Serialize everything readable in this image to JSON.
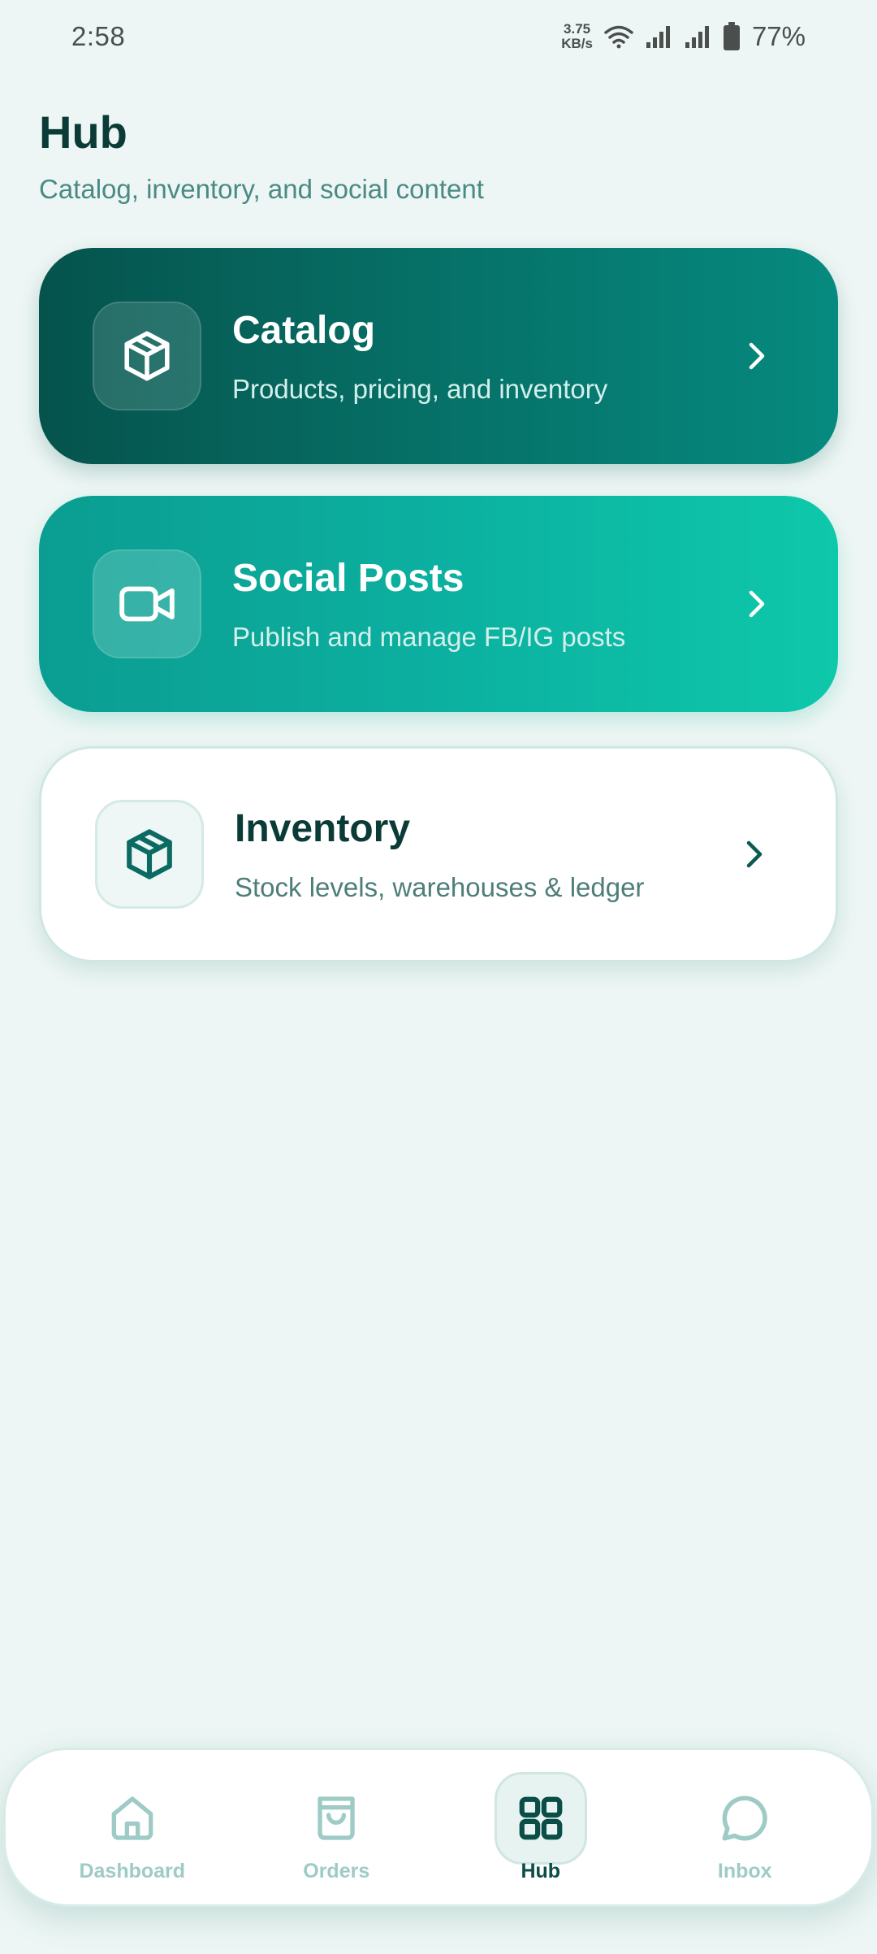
{
  "status_bar": {
    "time": "2:58",
    "net_speed_value": "3.75",
    "net_speed_unit": "KB/s",
    "battery": "77%"
  },
  "header": {
    "title": "Hub",
    "subtitle": "Catalog, inventory, and social content"
  },
  "cards": [
    {
      "title": "Catalog",
      "description": "Products, pricing, and inventory",
      "icon": "package-icon"
    },
    {
      "title": "Social Posts",
      "description": "Publish and manage FB/IG posts",
      "icon": "video-icon"
    },
    {
      "title": "Inventory",
      "description": "Stock levels, warehouses & ledger",
      "icon": "package-icon"
    }
  ],
  "nav": {
    "items": [
      {
        "label": "Dashboard",
        "icon": "home-icon",
        "active": false
      },
      {
        "label": "Orders",
        "icon": "shopping-bag-icon",
        "active": false
      },
      {
        "label": "Hub",
        "icon": "grid-icon",
        "active": true
      },
      {
        "label": "Inbox",
        "icon": "chat-bubble-icon",
        "active": false
      }
    ]
  },
  "colors": {
    "background": "#edf6f4",
    "primary_dark": "#05534c",
    "accent_teal": "#0ec8aa",
    "nav_inactive": "#9ecbc5"
  }
}
